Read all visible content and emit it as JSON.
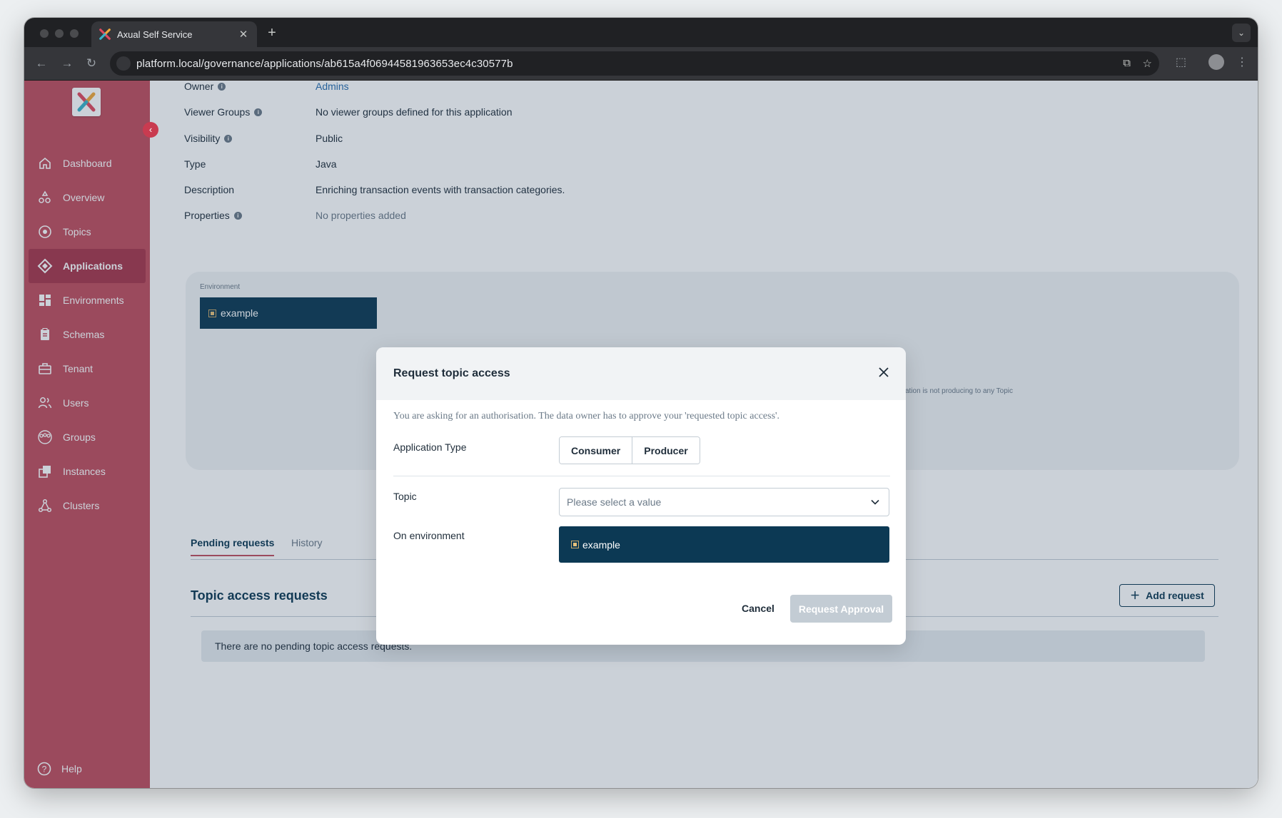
{
  "browser": {
    "tab_title": "Axual Self Service",
    "url": "platform.local/governance/applications/ab615a4f06944581963653ec4c30577b"
  },
  "sidebar": {
    "items": [
      {
        "label": "Dashboard",
        "icon": "home-icon"
      },
      {
        "label": "Overview",
        "icon": "overview-icon"
      },
      {
        "label": "Topics",
        "icon": "topics-icon"
      },
      {
        "label": "Applications",
        "icon": "applications-icon",
        "active": true
      },
      {
        "label": "Environments",
        "icon": "environments-icon"
      },
      {
        "label": "Schemas",
        "icon": "schemas-icon"
      },
      {
        "label": "Tenant",
        "icon": "tenant-icon"
      },
      {
        "label": "Users",
        "icon": "users-icon"
      },
      {
        "label": "Groups",
        "icon": "groups-icon"
      },
      {
        "label": "Instances",
        "icon": "instances-icon"
      },
      {
        "label": "Clusters",
        "icon": "clusters-icon"
      }
    ],
    "help_label": "Help",
    "accent_color": "#c04e5e"
  },
  "details": {
    "owner_label": "Owner",
    "owner_value": "Admins",
    "viewer_groups_label": "Viewer Groups",
    "viewer_groups_value": "No viewer groups defined for this application",
    "visibility_label": "Visibility",
    "visibility_value": "Public",
    "type_label": "Type",
    "type_value": "Java",
    "description_label": "Description",
    "description_value": "Enriching transaction events with transaction categories.",
    "properties_label": "Properties",
    "properties_value": "No properties added"
  },
  "environment_panel": {
    "caption": "Environment",
    "selected": "example",
    "note": "ation is not producing to any Topic"
  },
  "requests": {
    "tabs": [
      "Pending requests",
      "History"
    ],
    "section_title": "Topic access requests",
    "add_button": "Add request",
    "empty_message": "There are no pending topic access requests."
  },
  "modal": {
    "title": "Request topic access",
    "description": "You are asking for an authorisation. The data owner has to approve your 'requested topic access'.",
    "application_type_label": "Application Type",
    "application_type_options": [
      "Consumer",
      "Producer"
    ],
    "topic_label": "Topic",
    "topic_placeholder": "Please select a value",
    "environment_label": "On environment",
    "environment_value": "example",
    "cancel_label": "Cancel",
    "approve_label": "Request Approval"
  }
}
